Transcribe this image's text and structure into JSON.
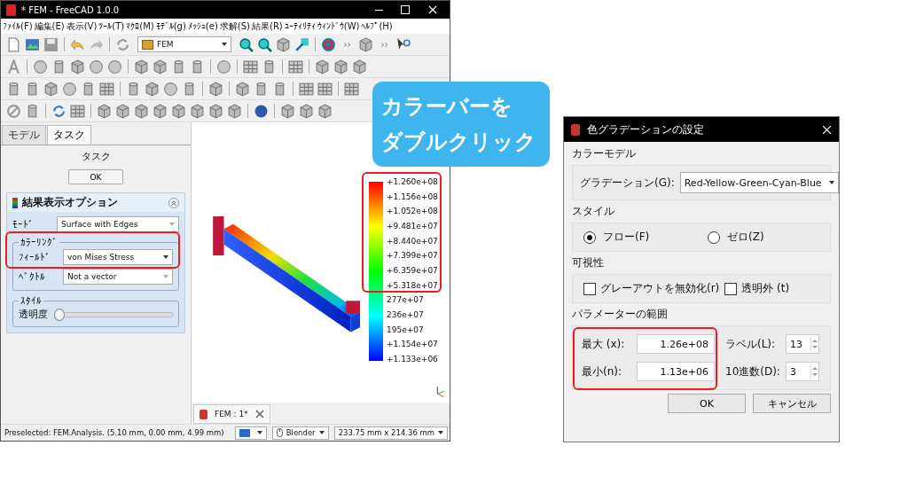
{
  "freecad_window": {
    "title": "* FEM - FreeCAD 1.0.0",
    "menu": [
      "ﾌｧｲﾙ(F)",
      "編集(E)",
      "表示(V)",
      "ﾂｰﾙ(T)",
      "ﾏｸﾛ(M)",
      "ﾓﾃﾞﾙ(g)",
      "ﾒｯｼｭ(e)",
      "求解(S)",
      "結果(R)",
      "ﾕｰﾃｨﾘﾃｨ",
      "ｳｨﾝﾄﾞｳ(W)",
      "ﾍﾙﾌﾟ(H)"
    ],
    "workbench": "FEM",
    "panel_tabs": [
      {
        "label": "モデル",
        "selected": false
      },
      {
        "label": "タスク",
        "selected": true
      }
    ],
    "task_title": "タスク",
    "ok_button": "OK",
    "result_panel": {
      "title": "結果表示オプション",
      "mode_label": "ﾓｰﾄﾞ",
      "mode": "Surface with Edges",
      "coloring": {
        "legend": "ｶﾗｰﾘﾝｸﾞ",
        "field_label": "ﾌｨｰﾙﾄﾞ",
        "field": "von Mises Stress",
        "vector_label": "ﾍﾞｸﾄﾙ",
        "vector": "Not a vector"
      },
      "style": {
        "legend": "ｽﾀｲﾙ",
        "transparency_label": "透明度",
        "level": 0
      }
    },
    "color_bar_labels": [
      "+1.260e+08",
      "+1.156e+08",
      "+1.052e+08",
      "+9.481e+07",
      "+8.440e+07",
      "+7.399e+07",
      "+6.359e+07",
      "+5.318e+07",
      "277e+07",
      "236e+07",
      "195e+07",
      "+1.154e+07",
      "+1.133e+06"
    ],
    "document_tab": "FEM : 1*",
    "status_bar": {
      "message": "Preselected: FEM.Analysis. (5.10 mm, 0.00 mm, 4.99 mm)",
      "navigation": "Blender",
      "dimensions": "233.75 mm x 214.36 mm"
    }
  },
  "callout": [
    "カラーバーを",
    "ダブルクリック"
  ],
  "gradient_dialog": {
    "title": "色グラデーションの設定",
    "color_model": {
      "heading": "カラーモデル",
      "label": "グラデーション(G):",
      "value": "Red-Yellow-Green-Cyan-Blue"
    },
    "style": {
      "heading": "スタイル",
      "options": [
        {
          "label": "フロー(F)",
          "selected": true
        },
        {
          "label": "ゼロ(Z)",
          "selected": false
        }
      ]
    },
    "visibility": {
      "heading": "可視性",
      "options": [
        {
          "label": "グレーアウトを無効化(r)",
          "checked": false
        },
        {
          "label": "透明外 (t)",
          "checked": false
        }
      ]
    },
    "range": {
      "heading": "パラメーターの範囲",
      "max_label": "最大 (x):",
      "max": "1.26e+08",
      "min_label": "最小(n):",
      "min": "1.13e+06",
      "labels_label": "ラベル(L):",
      "labels": "13",
      "decimals_label": "10進数(D):",
      "decimals": "3"
    },
    "buttons": [
      "OK",
      "キャンセル"
    ]
  }
}
